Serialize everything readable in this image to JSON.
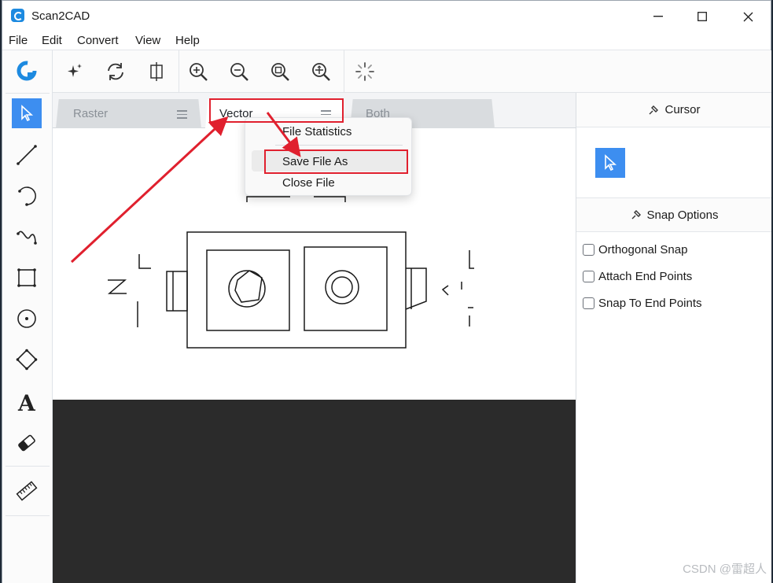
{
  "window": {
    "title": "Scan2CAD"
  },
  "menu": {
    "items": [
      "File",
      "Edit",
      "Convert",
      "View",
      "Help"
    ]
  },
  "left_tools": [
    "select-tool-icon",
    "line-tool-icon",
    "arc-tool-icon",
    "curve-tool-icon",
    "rectangle-tool-icon",
    "circle-tool-icon",
    "polygon-tool-icon",
    "text-tool-icon",
    "eraser-tool-icon",
    "ruler-tool-icon"
  ],
  "top_tools": [
    "magic-wand-icon",
    "rotate-icon",
    "crop-icon",
    "zoom-in-icon",
    "zoom-out-icon",
    "zoom-fit-icon",
    "zoom-region-icon",
    "loading-icon"
  ],
  "tabs": [
    {
      "label": "Raster",
      "active": false
    },
    {
      "label": "Vector",
      "active": true
    },
    {
      "label": "Both",
      "active": false
    }
  ],
  "context_menu": {
    "items": [
      "File Statistics",
      "Save File As",
      "Close File"
    ],
    "highlighted": "Save File As"
  },
  "right_panel": {
    "cursor_header": "Cursor",
    "snap_header": "Snap Options",
    "snap_options": [
      {
        "label": "Orthogonal Snap",
        "checked": false
      },
      {
        "label": "Attach End Points",
        "checked": false
      },
      {
        "label": "Snap To End Points",
        "checked": false
      }
    ]
  },
  "watermark": "CSDN @雷超人",
  "colors": {
    "accent": "#3d8ef0",
    "annotation": "#e0202e",
    "dark_area": "#2b2b2b"
  }
}
